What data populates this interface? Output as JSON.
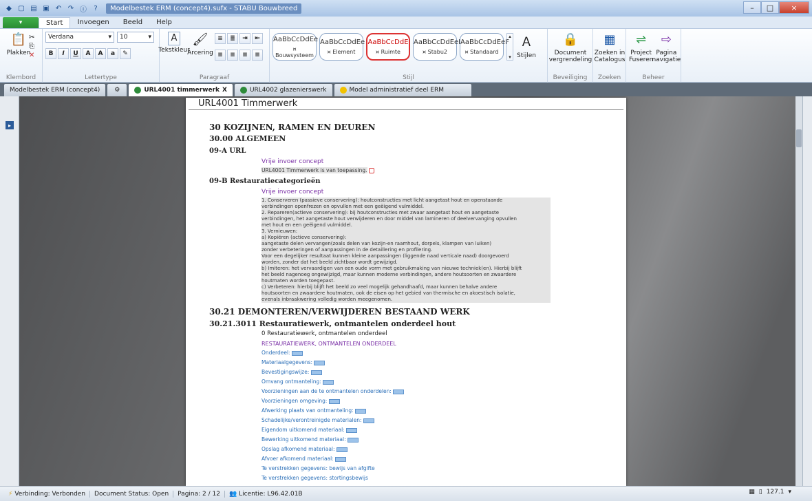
{
  "window": {
    "title": "Modelbestek ERM (concept4).sufx - STABU Bouwbreed",
    "close_icon": "×",
    "min_icon": "–",
    "max_icon": "□"
  },
  "ribbon_tabs": {
    "file_label": "",
    "tabs": [
      "Start",
      "Invoegen",
      "Beeld",
      "Help"
    ]
  },
  "ribbon": {
    "clipboard": {
      "paste_label": "Plakken",
      "group_label": "Klembord"
    },
    "font": {
      "family": "Verdana",
      "size": "10",
      "group_label": "Lettertype"
    },
    "paragraph": {
      "text_color_label": "Tekstkleur",
      "shading_label": "Arcering",
      "group_label": "Paragraaf"
    },
    "styles": {
      "items": [
        {
          "preview": "AaBbCcDdEe",
          "name": "¤ Bouwsysteem"
        },
        {
          "preview": "AaBbCcDdEe",
          "name": "¤ Element"
        },
        {
          "preview": "AaBbCcDdE",
          "name": "¤ Ruimte"
        },
        {
          "preview": "AaBbCcDdEeF",
          "name": "¤ Stabu2"
        },
        {
          "preview": "AaBbCcDdEeF",
          "name": "¤ Standaard"
        }
      ],
      "styles_button_label": "Stijlen",
      "group_label": "Stijl"
    },
    "security": {
      "lock_label": "Document vergrendeling",
      "group_label": "Beveiliging"
    },
    "search": {
      "catalog_label": "Zoeken in Catalogus",
      "group_label": "Zoeken"
    },
    "manage": {
      "merge_label": "Project Fuseren",
      "nav_label": "Pagina navigatie",
      "group_label": "Beheer"
    }
  },
  "doc_tabs": [
    {
      "label": "Modelbestek ERM (concept4)",
      "color": ""
    },
    {
      "label": "URL4001 timmerwerk",
      "color": "#2e8b3a",
      "active": true
    },
    {
      "label": "URL4002 glazenierswerk",
      "color": "#2e8b3a"
    },
    {
      "label": "Model administratief deel ERM",
      "color": "#f2c200"
    }
  ],
  "page": {
    "header": "URL4001 Timmerwerk",
    "h1": "30 KOZIJNEN, RAMEN EN DEUREN",
    "h2_general": "30.00 ALGEMEEN",
    "h3_a": "09-A URL",
    "free_input_1": "Vrije invoer concept",
    "applies_text": "URL4001 Timmerwerk is van toepassing.",
    "h3_b": "09-B Restauratiecategorieën",
    "free_input_2": "Vrije invoer concept",
    "categories_text": "1. Conserveren (passieve conservering): houtconstructies met licht aangetast hout en openstaande\nverbindingen openfrezen en opvullen met een geëigend vulmiddel.\n2. Repareren(actieve conservering): bij houtconstructies met zwaar aangetast hout en aangetaste\nverbindingen, het aangetaste hout verwijderen en door middel van lamineren of deelvervanging opvullen\nmet hout en een geëigend vulmiddel.\n3. Vernieuwen:\na) Kopiëren (actieve conservering):\naangetaste delen vervangen(zoals delen van kozijn-en raamhout, dorpels, klampen van luiken)\nzonder verbeteringen of aanpassingen in de detaillering en profilering.\nVoor een degelijker resultaat kunnen kleine aanpassingen (liggende naad verticale naad) doorgevoerd\nworden, zonder dat het beeld zichtbaar wordt gewijzigd.\nb) Imiteren: het vervaardigen van een oude vorm met gebruikmaking van nieuwe techniek(en). Hierbij blijft\nhet beeld nagenoeg ongewijzigd, maar kunnen moderne verbindingen, andere houtsoorten en zwaardere\nhoutmaten worden toegepast.\nc) Verbeteren: hierbij blijft het beeld zo veel mogelijk gehandhaafd, maar kunnen behalve andere\nhoutsoorten en zwaardere houtmaten, ook de eisen op het gebied van thermische en akoestisch isolatie,\nevenals inbraakwering volledig worden meegenomen.",
    "h2_demo": "30.21 DEMONTEREN/VERWIJDEREN BESTAAND WERK",
    "h2_sub": "30.21.3011 Restauratiewerk, ontmantelen onderdeel hout",
    "item_line": "0 Restauratiewerk, ontmantelen onderdeel",
    "section_caps": "RESTAURATIEWERK, ONTMANTELEN ONDERDEEL",
    "fields": [
      "Onderdeel:",
      "Materiaalgegevens:",
      "Bevestigingswijze:",
      "Omvang ontmanteling:",
      "Voorzieningen aan de te ontmantelen onderdelen:",
      "Voorzieningen omgeving:",
      "Afwerking plaats van ontmanteling:",
      "Schadelijke/verontreinigde materialen:",
      "Eigendom uitkomend materiaal:",
      "Bewerking uitkomend materiaal:",
      "Opslag afkomend materiaal:",
      "Afvoer afkomend materiaal:"
    ],
    "plain_fields": [
      "Te verstrekken gegevens: bewijs van afgifte",
      "Te verstrekken gegevens: stortingsbewijs"
    ]
  },
  "status": {
    "connection": "Verbinding: Verbonden",
    "doc_status": "Document Status:  Open",
    "page": "Pagina:  2 / 12",
    "license": "Licentie: L96.42.01B",
    "zoom": "127.1"
  }
}
